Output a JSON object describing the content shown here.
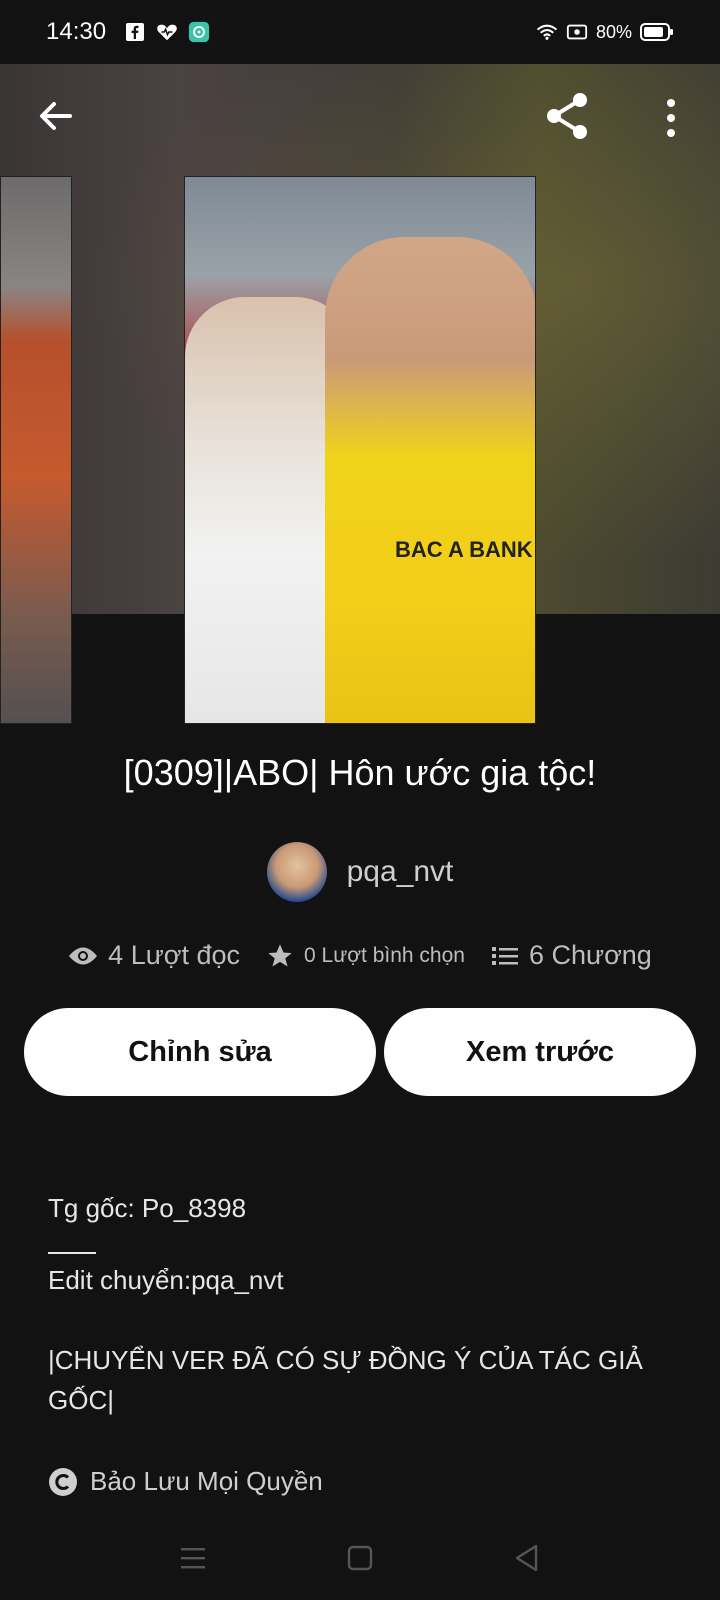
{
  "status_bar": {
    "time": "14:30",
    "battery": "80%",
    "icons": [
      "facebook-icon",
      "heart-app-icon",
      "chat-app-icon",
      "wifi-icon",
      "screen-record-icon",
      "battery-icon"
    ]
  },
  "header": {
    "back_icon": "arrow-left-icon",
    "share_icon": "share-icon",
    "more_icon": "more-vertical-icon"
  },
  "cover": {
    "jersey_text": "BAC A BANK"
  },
  "story": {
    "title": "[0309]|ABO| Hôn ước gia tộc!",
    "author": "pqa_nvt"
  },
  "stats": {
    "reads": "4 Lượt đọc",
    "votes": "0 Lượt bình chọn",
    "chapters": "6 Chương"
  },
  "actions": {
    "edit_label": "Chỉnh sửa",
    "preview_label": "Xem trước"
  },
  "description": {
    "line1": "Tg gốc: Po_8398",
    "line2": "Edit chuyển:pqa_nvt",
    "line3": "|CHUYỂN VER ĐÃ CÓ SỰ ĐỒNG Ý CỦA TÁC GIẢ GỐC|"
  },
  "copyright": "Bảo Lưu Mọi Quyền",
  "colors": {
    "background": "#121212",
    "button_bg": "#ffffff",
    "muted_text": "#bdbdbd"
  }
}
